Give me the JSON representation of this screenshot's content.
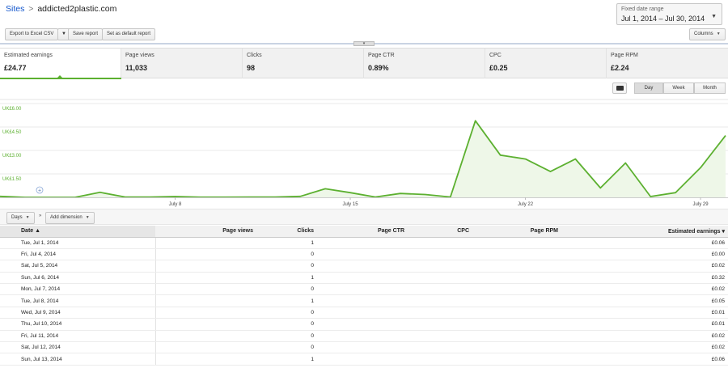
{
  "breadcrumb": {
    "root": "Sites",
    "separator": ">",
    "site": "addicted2plastic.com"
  },
  "date_range": {
    "label": "Fixed date range",
    "value": "Jul 1, 2014 – Jul 30, 2014"
  },
  "toolbar": {
    "export_label": "Export to Excel CSV",
    "save_label": "Save report",
    "default_label": "Set as default report",
    "columns_label": "Columns"
  },
  "metrics": [
    {
      "name": "Estimated earnings",
      "value": "£24.77",
      "active": true
    },
    {
      "name": "Page views",
      "value": "11,033"
    },
    {
      "name": "Clicks",
      "value": "98"
    },
    {
      "name": "Page CTR",
      "value": "0.89%"
    },
    {
      "name": "CPC",
      "value": "£0.25"
    },
    {
      "name": "Page RPM",
      "value": "£2.24"
    }
  ],
  "granularity": {
    "day": "Day",
    "week": "Week",
    "month": "Month",
    "selected": "Day"
  },
  "chart_data": {
    "type": "area",
    "color": "#5cb030",
    "fill": "#eef7e8",
    "y_ticks": [
      "UK£6.00",
      "UK£4.50",
      "UK£3.00",
      "UK£1.50"
    ],
    "ylim": [
      0,
      6.0
    ],
    "x_ticks": [
      "July 8",
      "July 15",
      "July 22",
      "July 29"
    ],
    "x": [
      1,
      2,
      3,
      4,
      5,
      6,
      7,
      8,
      9,
      10,
      11,
      12,
      13,
      14,
      15,
      16,
      17,
      18,
      19,
      20,
      21,
      22,
      23,
      24,
      25,
      26,
      27,
      28,
      29,
      30
    ],
    "values": [
      0.06,
      0.0,
      0.0,
      0.0,
      0.32,
      0.02,
      0.02,
      0.05,
      0.01,
      0.01,
      0.02,
      0.02,
      0.06,
      0.55,
      0.3,
      0.02,
      0.25,
      0.18,
      0.02,
      4.9,
      2.7,
      2.45,
      1.65,
      2.45,
      0.6,
      2.2,
      0.05,
      0.3,
      1.9,
      3.95
    ]
  },
  "table_toolbar": {
    "days_label": "Days",
    "arrows": "»",
    "add_dimension_label": "Add dimension"
  },
  "table": {
    "headers": [
      "Date",
      "Page views",
      "Clicks",
      "Page CTR",
      "CPC",
      "Page RPM",
      "Estimated earnings"
    ],
    "rows": [
      {
        "date": "Tue, Jul 1, 2014",
        "clicks": "1",
        "earnings": "£0.06"
      },
      {
        "date": "Fri, Jul 4, 2014",
        "clicks": "0",
        "earnings": "£0.00"
      },
      {
        "date": "Sat, Jul 5, 2014",
        "clicks": "0",
        "earnings": "£0.02"
      },
      {
        "date": "Sun, Jul 6, 2014",
        "clicks": "1",
        "earnings": "£0.32"
      },
      {
        "date": "Mon, Jul 7, 2014",
        "clicks": "0",
        "earnings": "£0.02"
      },
      {
        "date": "Tue, Jul 8, 2014",
        "clicks": "1",
        "earnings": "£0.05"
      },
      {
        "date": "Wed, Jul 9, 2014",
        "clicks": "0",
        "earnings": "£0.01"
      },
      {
        "date": "Thu, Jul 10, 2014",
        "clicks": "0",
        "earnings": "£0.01"
      },
      {
        "date": "Fri, Jul 11, 2014",
        "clicks": "0",
        "earnings": "£0.02"
      },
      {
        "date": "Sat, Jul 12, 2014",
        "clicks": "0",
        "earnings": "£0.02"
      },
      {
        "date": "Sun, Jul 13, 2014",
        "clicks": "1",
        "earnings": "£0.06"
      }
    ]
  }
}
